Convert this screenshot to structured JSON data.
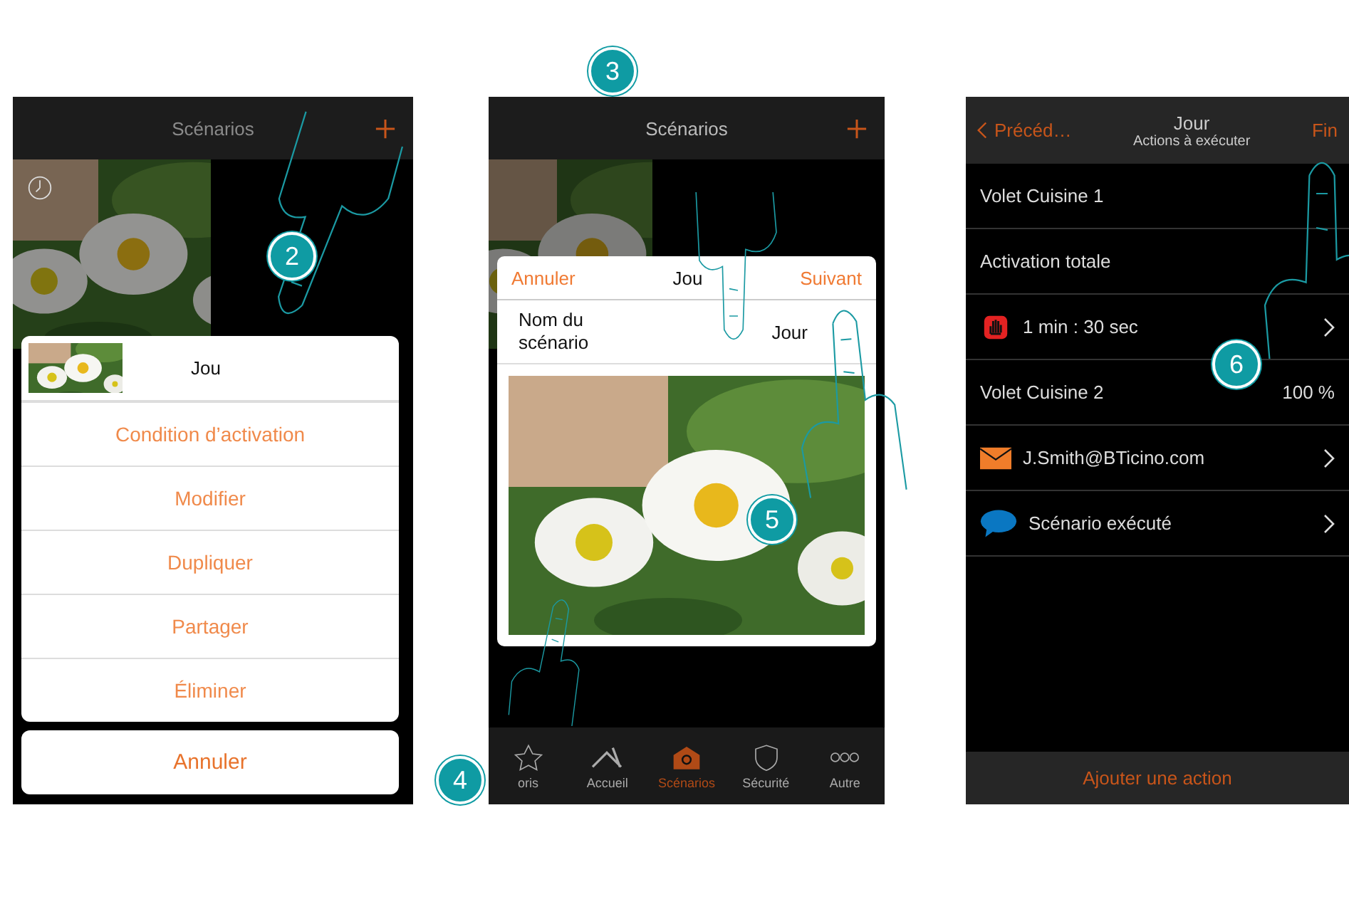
{
  "screen_1": {
    "title": "Scénarios",
    "sheet_title": "Jou",
    "menu_items": [
      "Condition d’activation",
      "Modifier",
      "Dupliquer",
      "Partager",
      "Éliminer"
    ],
    "cancel": "Annuler"
  },
  "screen_2": {
    "title": "Scénarios",
    "dialog": {
      "cancel": "Annuler",
      "title": "Jou",
      "next": "Suivant",
      "name_label": "Nom du scénario",
      "name_value": "Jour"
    },
    "tabs": [
      {
        "label": "oris",
        "selected": false
      },
      {
        "label": "Accueil",
        "selected": false
      },
      {
        "label": "Scénarios",
        "selected": true
      },
      {
        "label": "Sécurité",
        "selected": false
      },
      {
        "label": "Autre",
        "selected": false
      }
    ]
  },
  "screen_3": {
    "back": "Précéd…",
    "title": "Jour",
    "subtitle": "Actions à exécuter",
    "done": "Fin",
    "rows": [
      {
        "kind": "plain",
        "label": "Volet Cuisine 1",
        "chevron": false
      },
      {
        "kind": "plain",
        "label": "Activation totale",
        "chevron": false
      },
      {
        "kind": "timer",
        "label": "1 min : 30 sec",
        "chevron": true
      },
      {
        "kind": "plain",
        "label": "Volet Cuisine 2",
        "value": "100 %",
        "chevron": false
      },
      {
        "kind": "email",
        "label": "J.Smith@BTicino.com",
        "chevron": true
      },
      {
        "kind": "message",
        "label": "Scénario exécuté",
        "chevron": true
      }
    ],
    "add_action": "Ajouter une action"
  },
  "steps": [
    "2",
    "3",
    "4",
    "5",
    "6"
  ]
}
